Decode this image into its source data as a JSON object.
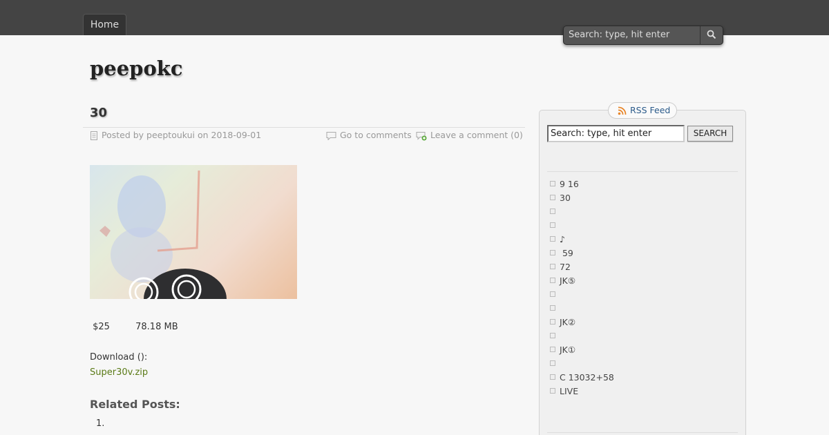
{
  "nav": {
    "home_label": "Home"
  },
  "header": {
    "search_placeholder": "Search: type, hit enter",
    "site_title": "peepokc"
  },
  "post": {
    "title": "30",
    "posted_by_label": "Posted by peeptoukui on 2018-09-01",
    "go_to_comments": "Go to comments",
    "leave_comment": "Leave a comment (0)",
    "price_line": " $25         78.18 MB",
    "download_label": "Download ():",
    "download_link": "Super30v.zip",
    "related_heading": "Related Posts:",
    "related_first_number": "1."
  },
  "sidebar": {
    "rss_label": "RSS Feed",
    "search_value": "Search: type, hit enter",
    "search_button": "SEARCH",
    "items": [
      "9 16",
      "30",
      "",
      "",
      "♪",
      " 59",
      "72",
      "JK⑤",
      "",
      "",
      "JK②",
      "",
      "JK①",
      "",
      "C 13032+58",
      "LIVE"
    ]
  },
  "colors": {
    "topbar": "#444444",
    "link_green": "#5a7a16",
    "rss_blue": "#2a5a8a"
  }
}
